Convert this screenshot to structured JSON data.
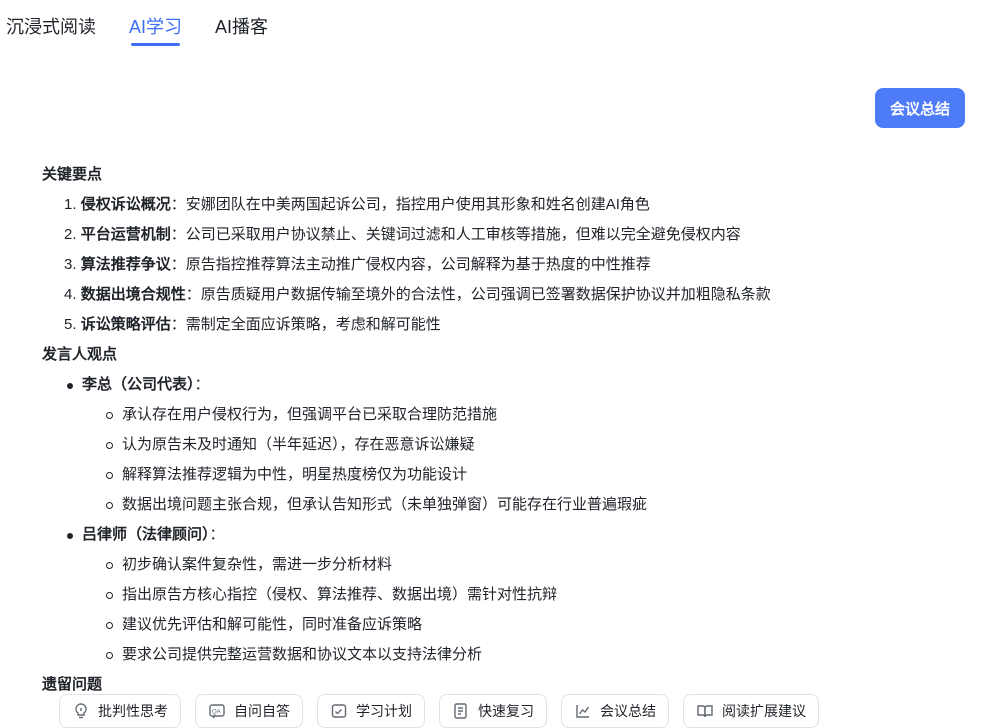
{
  "tabs": [
    {
      "label": "沉浸式阅读",
      "active": false
    },
    {
      "label": "AI学习",
      "active": true
    },
    {
      "label": "AI播客",
      "active": false
    }
  ],
  "summary_button": "会议总结",
  "key_points": {
    "title": "关键要点",
    "items": [
      {
        "num": "1.",
        "head": "侵权诉讼概况",
        "sep": "：",
        "text": "安娜团队在中美两国起诉公司，指控用户使用其形象和姓名创建AI角色"
      },
      {
        "num": "2.",
        "head": "平台运营机制",
        "sep": "：",
        "text": "公司已采取用户协议禁止、关键词过滤和人工审核等措施，但难以完全避免侵权内容"
      },
      {
        "num": "3.",
        "head": "算法推荐争议",
        "sep": "：",
        "text": "原告指控推荐算法主动推广侵权内容，公司解释为基于热度的中性推荐"
      },
      {
        "num": "4.",
        "head": "数据出境合规性",
        "sep": "：",
        "text": "原告质疑用户数据传输至境外的合法性，公司强调已签署数据保护协议并加粗隐私条款"
      },
      {
        "num": "5.",
        "head": "诉讼策略评估",
        "sep": "：",
        "text": "需制定全面应诉策略，考虑和解可能性"
      }
    ]
  },
  "speakers": {
    "title": "发言人观点",
    "people": [
      {
        "name": "李总（公司代表）",
        "sep": "：",
        "points": [
          "承认存在用户侵权行为，但强调平台已采取合理防范措施",
          "认为原告未及时通知（半年延迟），存在恶意诉讼嫌疑",
          "解释算法推荐逻辑为中性，明星热度榜仅为功能设计",
          "数据出境问题主张合规，但承认告知形式（未单独弹窗）可能存在行业普遍瑕疵"
        ]
      },
      {
        "name": "吕律师（法律顾问）",
        "sep": "：",
        "points": [
          "初步确认案件复杂性，需进一步分析材料",
          "指出原告方核心指控（侵权、算法推荐、数据出境）需针对性抗辩",
          "建议优先评估和解可能性，同时准备应诉策略",
          "要求公司提供完整运营数据和协议文本以支持法律分析"
        ]
      }
    ]
  },
  "open_issues": {
    "title": "遗留问题"
  },
  "toolbar": [
    {
      "label": "批判性思考",
      "icon": "lightbulb-icon"
    },
    {
      "label": "自问自答",
      "icon": "qa-icon"
    },
    {
      "label": "学习计划",
      "icon": "plan-icon"
    },
    {
      "label": "快速复习",
      "icon": "review-icon"
    },
    {
      "label": "会议总结",
      "icon": "chart-icon"
    },
    {
      "label": "阅读扩展建议",
      "icon": "book-icon"
    }
  ],
  "colors": {
    "accent": "#3d6ef5",
    "button": "#4e7bf8"
  }
}
